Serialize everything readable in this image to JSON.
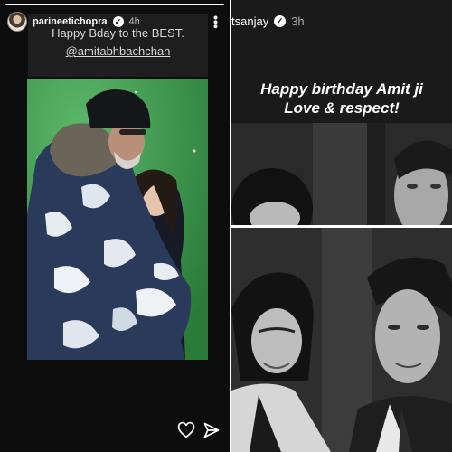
{
  "left_story": {
    "username": "parineetichopra",
    "verified_mark": "✓",
    "time": "4h",
    "more_icon": "⋮",
    "caption_line1": "Happy Bday to the BEST.",
    "caption_line2": "@amitabhbachchan",
    "progress": 1.0,
    "icons": [
      "heart-icon",
      "send-icon",
      "more-icon",
      "verified-icon"
    ]
  },
  "right_story": {
    "username": "tsanjay",
    "verified_mark": "✓",
    "time": "3h",
    "bday_line1": "Happy birthday Amit ji",
    "bday_line2": "Love & respect!"
  },
  "colors": {
    "left_bg": "#0d0d0d",
    "caption_bg": "#1e1e1e",
    "green_screen": "#3f9a4f",
    "right_bg": "#1a1a1a"
  }
}
